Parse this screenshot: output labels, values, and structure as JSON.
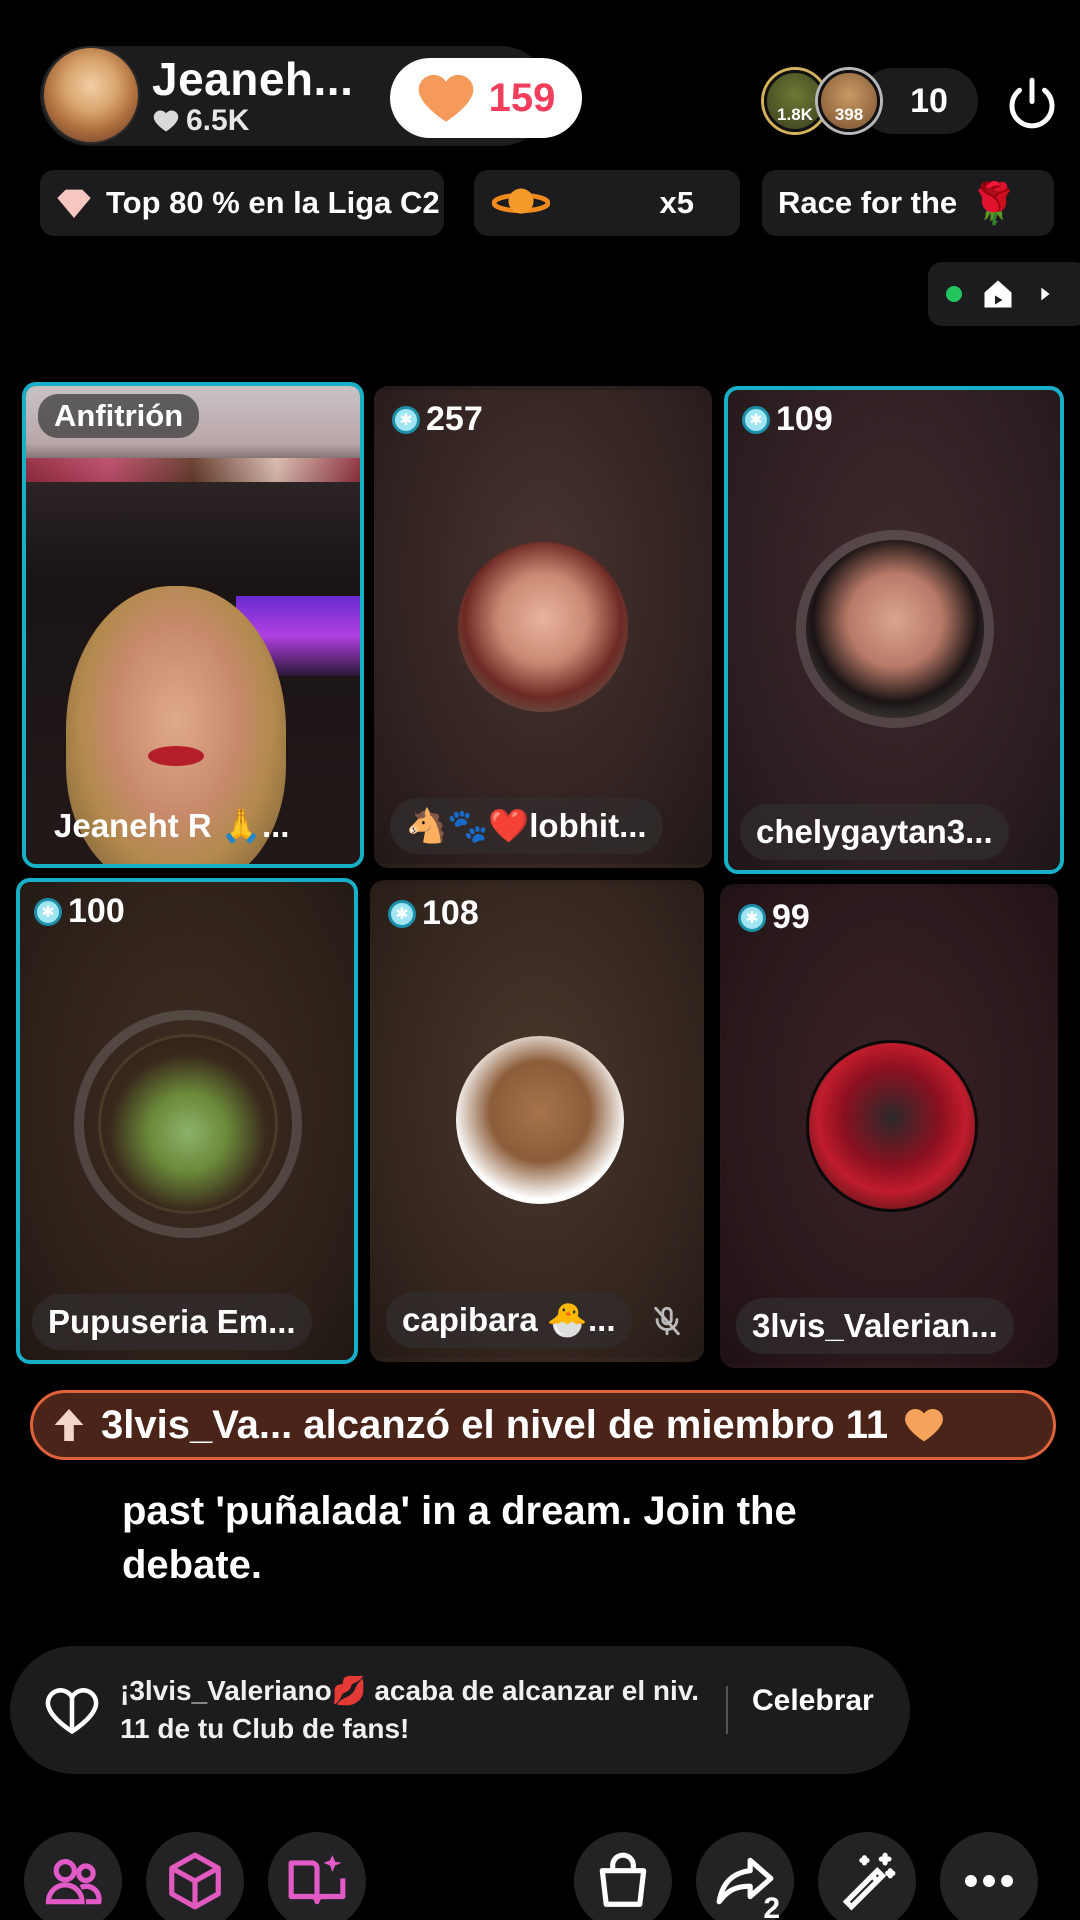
{
  "host": {
    "name": "Jeaneh...",
    "likes": "6.5K",
    "like_count": "159"
  },
  "viewers": {
    "avatar1_label": "1.8K",
    "avatar2_label": "398",
    "count": "10"
  },
  "chips": {
    "league": "Top 80 % en la Liga C2",
    "multiplier": "x5",
    "race": "Race for the"
  },
  "tiles": [
    {
      "tag": "Anfitrión",
      "name": "Jeaneht R 🙏..."
    },
    {
      "score": "257",
      "name": "🐴🐾❤️lobhit..."
    },
    {
      "score": "109",
      "name": "chelygaytan3..."
    },
    {
      "score": "100",
      "name": "Pupuseria Em..."
    },
    {
      "score": "108",
      "name": "capibara 🐣..."
    },
    {
      "score": "99",
      "name": "3lvis_Valerian..."
    }
  ],
  "level_banner": "3lvis_Va... alcanzó el nivel de miembro 11",
  "comment": "past 'puñalada' in a dream. Join the debate.",
  "fan_club": {
    "message": "¡3lvis_Valeriano💋 acaba de alcanzar el niv. 11 de tu Club de fans!",
    "action": "Celebrar"
  },
  "toolbar": {
    "share_count": "2"
  },
  "colors": {
    "accent_cyan": "#17b0c8",
    "like_red": "#f23d5c",
    "heart_orange": "#f59a5b",
    "banner_orange": "#e0623a"
  }
}
